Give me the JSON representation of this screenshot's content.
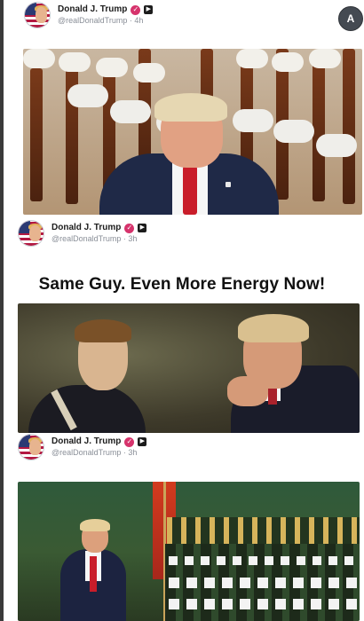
{
  "posts": [
    {
      "author": "Donald J. Trump",
      "handle": "@realDonaldTrump",
      "time": "4h"
    },
    {
      "author": "Donald J. Trump",
      "handle": "@realDonaldTrump",
      "time": "3h",
      "headline": "Same Guy. Even More Energy Now!"
    },
    {
      "author": "Donald J. Trump",
      "handle": "@realDonaldTrump",
      "time": "3h"
    }
  ],
  "ui": {
    "translate_icon_glyph": "A",
    "verified_glyph": "✓",
    "square_glyph": "▶"
  },
  "colors": {
    "verified_badge": "#d6336c",
    "tie_red": "#c91d2a",
    "suit_navy": "#1f2947"
  },
  "icons": {
    "translate": "translate-icon",
    "verified": "verified-badge-icon",
    "square_badge": "square-badge-icon"
  }
}
